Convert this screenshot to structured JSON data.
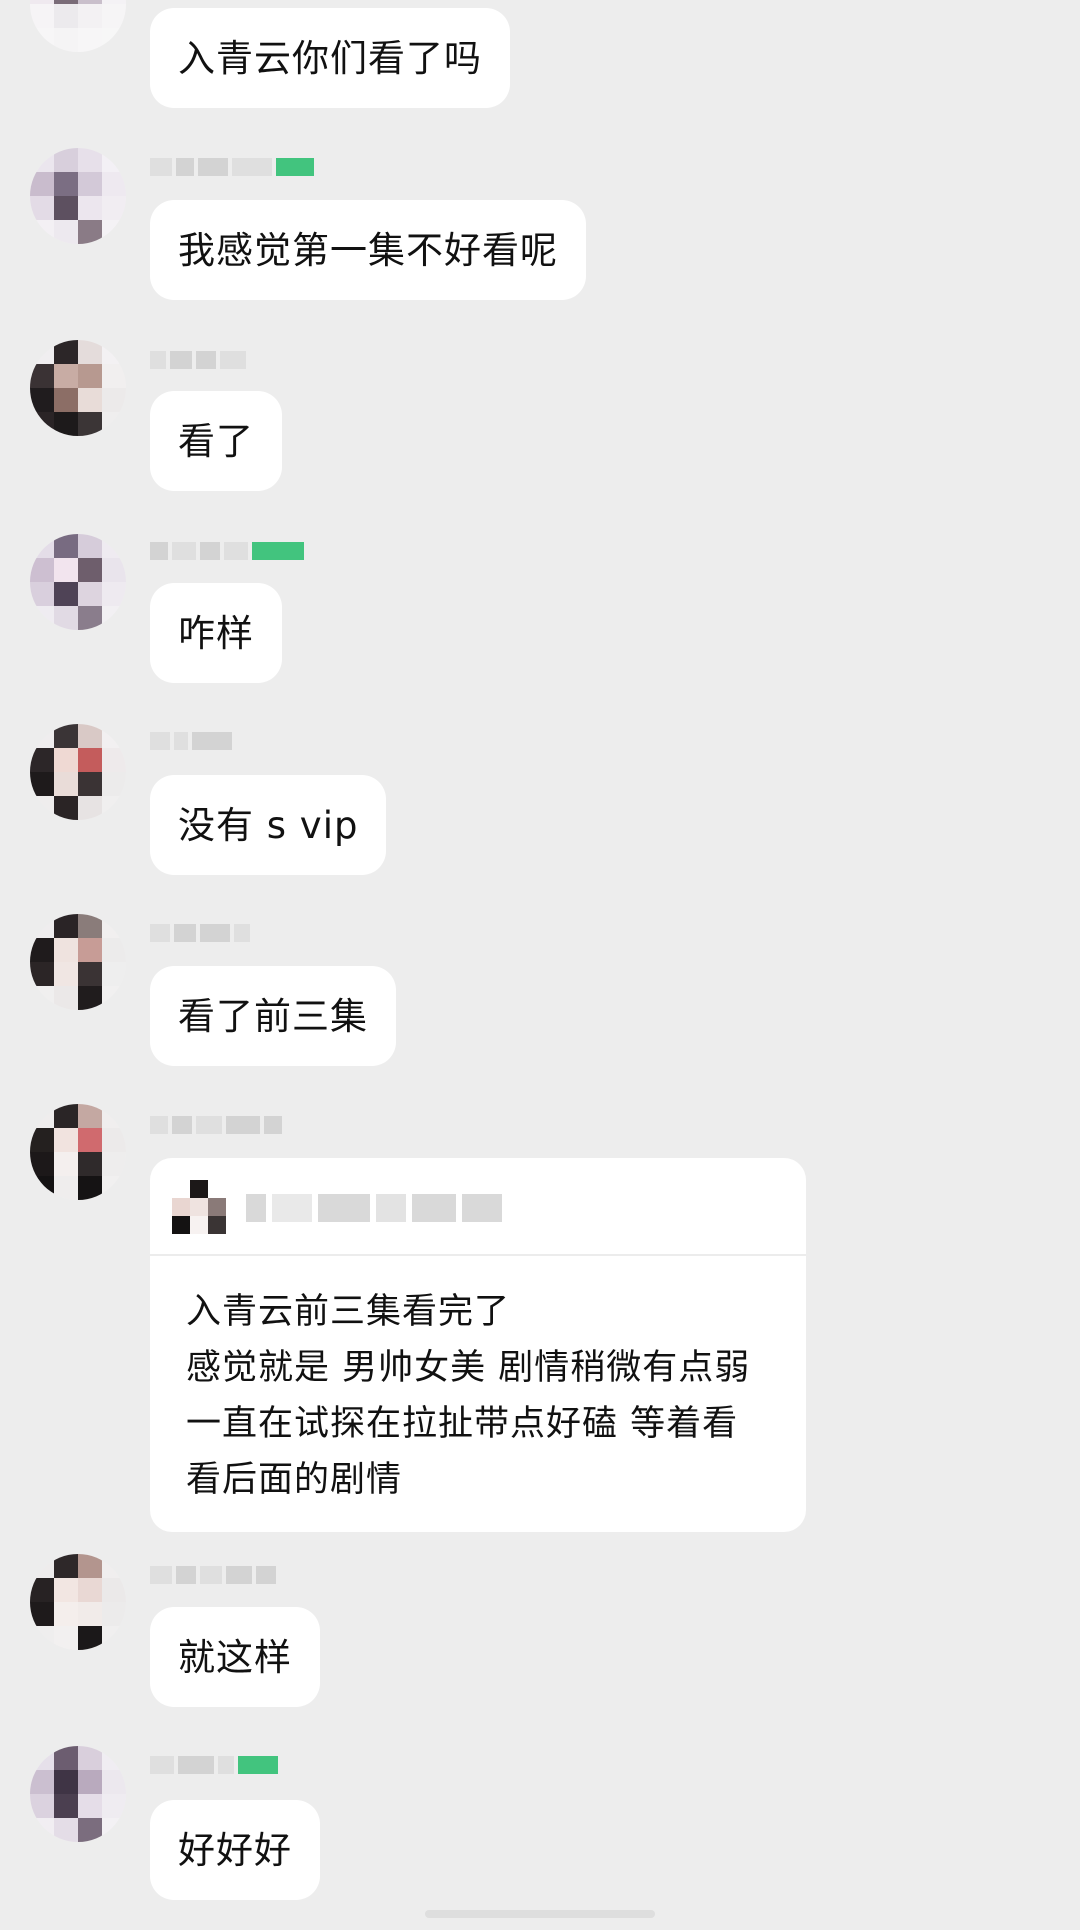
{
  "messages": [
    {
      "text": "入青云你们看了吗"
    },
    {
      "text": "我感觉第一集不好看呢"
    },
    {
      "text": "看了"
    },
    {
      "text": "咋样"
    },
    {
      "text": "没有 s vip"
    },
    {
      "text": "看了前三集"
    },
    {
      "quote_lines": [
        "入青云前三集看完了",
        "感觉就是 男帅女美 剧情稍微有点弱",
        "一直在试探在拉扯带点好磕 等着看",
        "看后面的剧情"
      ]
    },
    {
      "text": "就这样"
    },
    {
      "text": "好好好"
    }
  ],
  "colors": {
    "background": "#ededed",
    "bubble": "#ffffff",
    "badge": "#2fbf71"
  }
}
